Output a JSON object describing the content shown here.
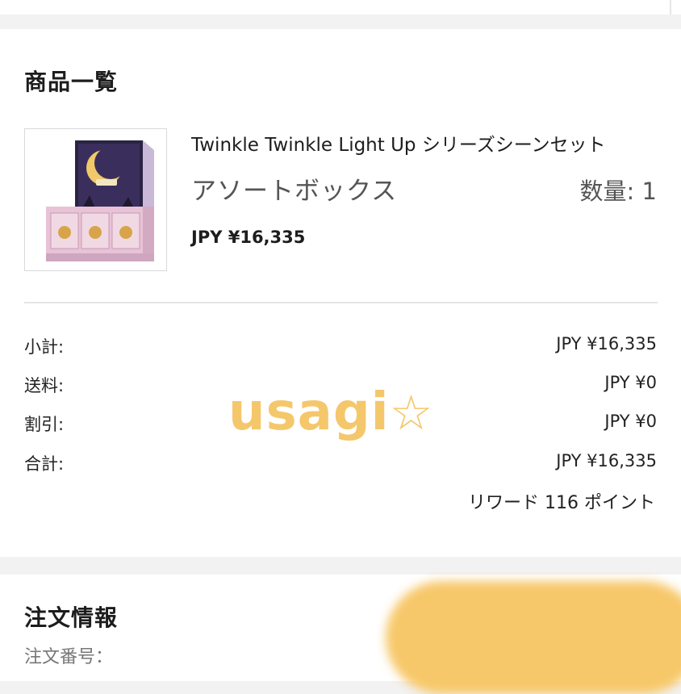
{
  "products_section": {
    "title": "商品一覧",
    "item": {
      "name": "Twinkle Twinkle Light Up シリーズシーンセット",
      "variant": "アソートボックス",
      "quantity": "数量: 1",
      "price": "JPY ¥16,335"
    }
  },
  "summary": {
    "rows": [
      {
        "label": "小計:",
        "value": "JPY ¥16,335"
      },
      {
        "label": "送料:",
        "value": "JPY ¥0"
      },
      {
        "label": "割引:",
        "value": "JPY ¥0"
      },
      {
        "label": "合計:",
        "value": "JPY ¥16,335"
      }
    ],
    "reward": "リワード 116 ポイント"
  },
  "watermark": {
    "text": "usagi",
    "star": "☆",
    "color": "#f5c76b"
  },
  "order_section": {
    "title": "注文情報",
    "order_number_label": "注文番号："
  }
}
